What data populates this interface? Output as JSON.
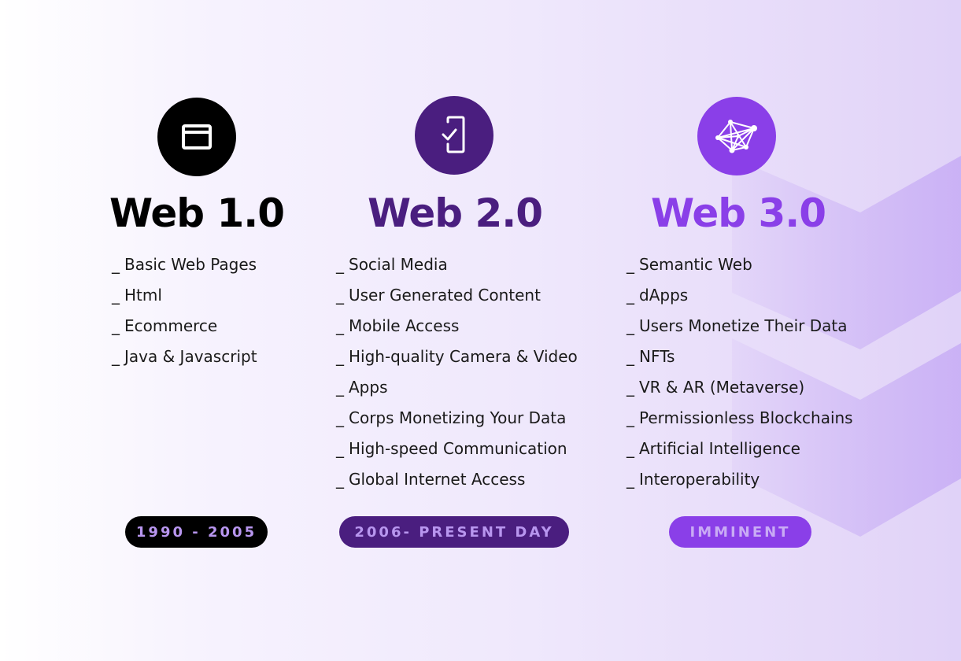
{
  "colors": {
    "web1": "#000000",
    "web2": "#4a1e7f",
    "web3": "#8a3fe8",
    "badge_text": "#b896ef",
    "deco": "#c8aef5"
  },
  "columns": [
    {
      "icon": "browser-window-icon",
      "title": "Web 1.0",
      "items": [
        "Basic Web Pages",
        "Html",
        "Ecommerce",
        "Java & Javascript"
      ],
      "era": "1990 - 2005"
    },
    {
      "icon": "mobile-check-icon",
      "title": "Web 2.0",
      "items": [
        "Social Media",
        "User Generated Content",
        "Mobile Access",
        "High-quality Camera & Video",
        "Apps",
        "Corps Monetizing Your Data",
        "High-speed Communication",
        "Global Internet Access"
      ],
      "era": "2006- PRESENT DAY"
    },
    {
      "icon": "network-graph-icon",
      "title": "Web 3.0",
      "items": [
        "Semantic Web",
        "dApps",
        "Users Monetize Their Data",
        "NFTs",
        "VR & AR (Metaverse)",
        "Permissionless Blockchains",
        "Artificial Intelligence",
        "Interoperability"
      ],
      "era": "IMMINENT"
    }
  ]
}
